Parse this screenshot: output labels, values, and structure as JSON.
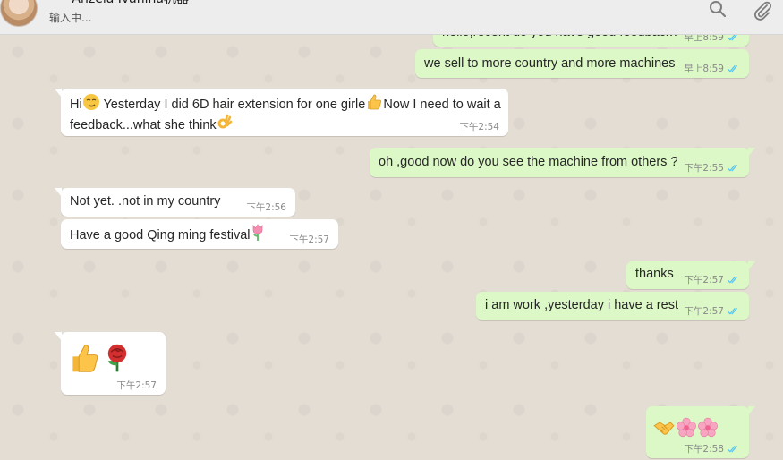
{
  "header": {
    "contact_name": "• • Anzela Ivanina机器",
    "status": "输入中..."
  },
  "icons": {
    "search": "search-icon",
    "attach": "paperclip-icon",
    "read_ticks": "double-check-icon"
  },
  "colors": {
    "outgoing_bubble": "#dcf8c6",
    "incoming_bubble": "#ffffff",
    "read_tick": "#4fc3f7",
    "wallpaper": "#e4ddd4"
  },
  "messages": [
    {
      "dir": "out",
      "text": "hello,recent do you have good feedback?",
      "time": "早上8:59"
    },
    {
      "dir": "out",
      "text": "we sell to more country and more machines",
      "time": "早上8:59"
    },
    {
      "dir": "in",
      "text_a": "Hi",
      "text_b": " Yesterday I did 6D hair extension for one girle",
      "text_c": "Now I need to wait a",
      "text_d": "feedback...what she think",
      "time": "下午2:54"
    },
    {
      "dir": "out",
      "text": "oh ,good now do you see the machine from others ?",
      "time": "下午2:55"
    },
    {
      "dir": "in",
      "text": "Not yet. .not in my country",
      "time": "下午2:56"
    },
    {
      "dir": "in",
      "text": "Have a good Qing ming festival",
      "time": "下午2:57"
    },
    {
      "dir": "out",
      "text": "thanks",
      "time": "下午2:57"
    },
    {
      "dir": "out",
      "text": "i am work ,yesterday i have a rest",
      "time": "下午2:57"
    },
    {
      "dir": "in",
      "text": "",
      "emojis": [
        "thumbs-up",
        "rose"
      ],
      "time": "下午2:57"
    },
    {
      "dir": "out",
      "text": "",
      "emojis": [
        "handshake",
        "cherry-blossom",
        "cherry-blossom"
      ],
      "time": "下午2:58"
    }
  ]
}
